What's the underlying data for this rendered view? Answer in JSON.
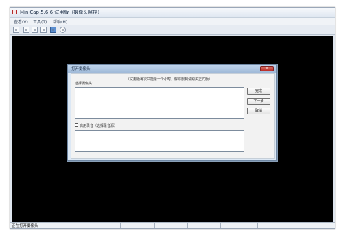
{
  "window": {
    "title": "MiniCap 5.6.6 试用版（摄像头监控）",
    "menu": [
      "查看(V)",
      "工具(T)",
      "帮助(H)"
    ],
    "status_text": "正在打开摄像头",
    "colors": {
      "workspace": "#000000",
      "window_frame": "#dfe6ef",
      "dialog_frame": "#dce8f5",
      "dialog_title": "#a9c1de",
      "close_button": "#c83a32"
    },
    "toolbar_icons": [
      "new-icon",
      "camera-icon",
      "record-icon",
      "stop-icon",
      "save-icon",
      "settings-icon"
    ]
  },
  "dialog": {
    "title": "打开摄像头",
    "hint": "（试用版每次只能录一个小时，解除限制请购买正式版）",
    "camera_label": "选择摄像头：",
    "buttons": {
      "finish": "完成",
      "next": "下一步",
      "cancel": "取消"
    },
    "audio_label": "启用录音（选择录音源）",
    "close": "x"
  }
}
